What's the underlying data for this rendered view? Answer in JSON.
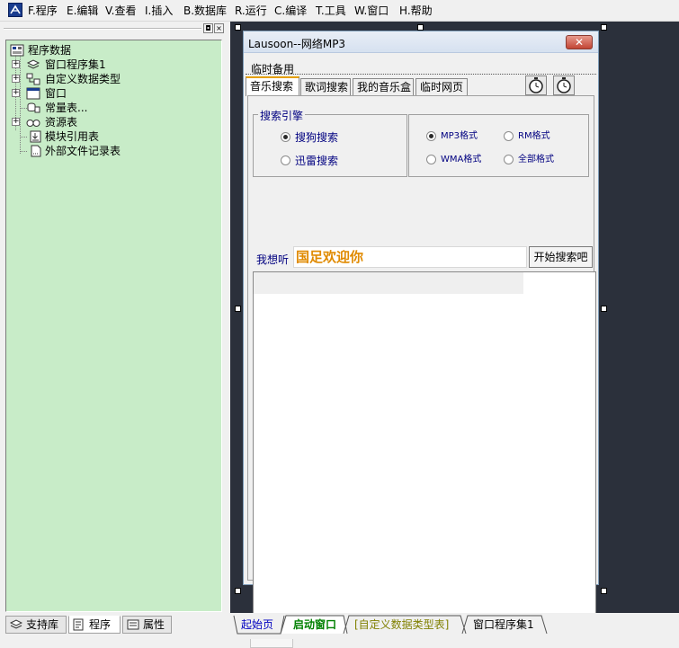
{
  "menu": {
    "items": [
      "F.程序",
      "E.编辑",
      "V.查看",
      "I.插入",
      "B.数据库",
      "R.运行",
      "C.编译",
      "T.工具",
      "W.窗口",
      "H.帮助"
    ]
  },
  "left_panel": {
    "pin_glyph": "◘",
    "close_glyph": "×",
    "tree": {
      "root": "程序数据",
      "items": [
        "窗口程序集1",
        "自定义数据类型",
        "窗口",
        "常量表...",
        "资源表",
        "模块引用表",
        "外部文件记录表"
      ]
    },
    "tabs": [
      "支持库",
      "程序",
      "属性"
    ]
  },
  "form": {
    "title": "Lausoon--网络MP3",
    "close_glyph": "✕",
    "menu_label": "临时备用",
    "tabs": [
      "音乐搜索",
      "歌词搜索",
      "我的音乐盒",
      "临时网页"
    ],
    "engine_group_label": "搜索引擎",
    "engines": [
      "搜狗搜索",
      "迅雷搜索"
    ],
    "formats": [
      "MP3格式",
      "RM格式",
      "WMA格式",
      "全部格式"
    ],
    "want_label": "我想听",
    "search_value": "国足欢迎你",
    "search_button": "开始搜索吧"
  },
  "bottom_tabs": [
    "起始页",
    "启动窗口",
    "[自定义数据类型表]",
    "窗口程序集1"
  ],
  "colors": {
    "tree_bg": "#c8ecc8",
    "design_bg": "#2b303b",
    "accent_orange": "#e08a00",
    "label_navy": "#000080",
    "active_tab_green": "#008000"
  }
}
